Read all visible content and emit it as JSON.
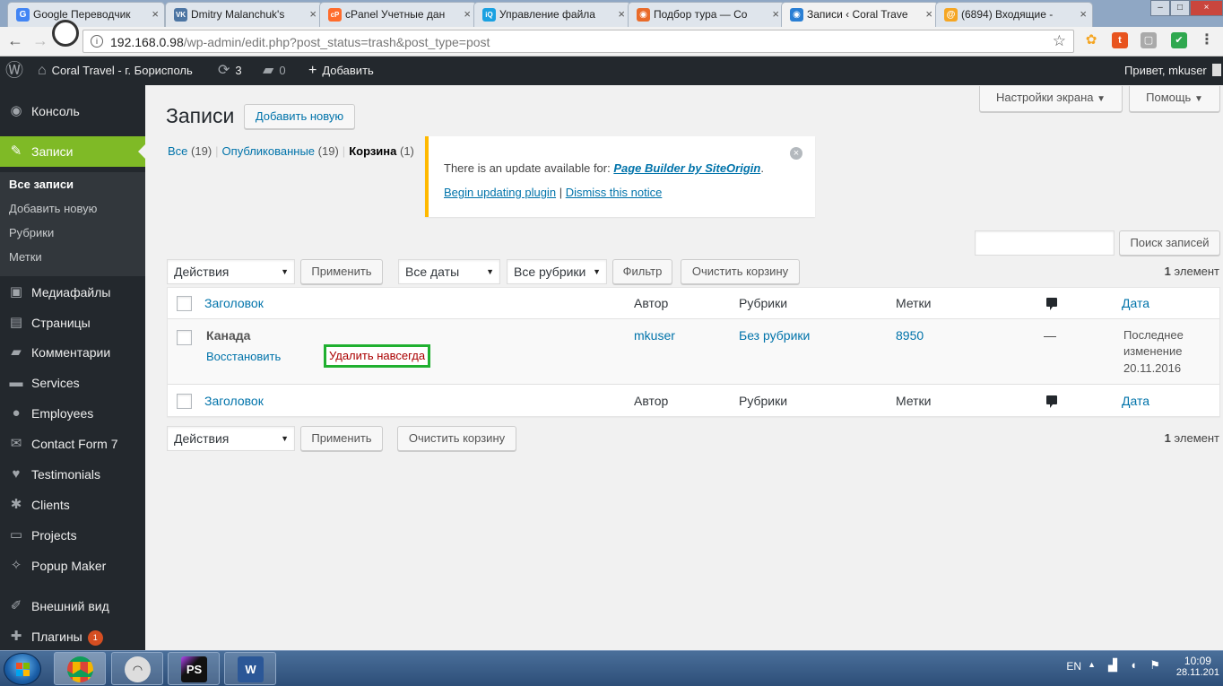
{
  "browser": {
    "tabs": [
      {
        "title": "Google Переводчик",
        "favicon": "G",
        "color": "#4285f4",
        "active": false
      },
      {
        "title": "Dmitry Malanchuk's",
        "favicon": "VK",
        "color": "#4c75a3",
        "active": false
      },
      {
        "title": "cPanel Учетные дан",
        "favicon": "cP",
        "color": "#ff6c2c",
        "active": false
      },
      {
        "title": "Управление файла",
        "favicon": "iQ",
        "color": "#1aa1e1",
        "active": false
      },
      {
        "title": "Подбор тура — Co",
        "favicon": "◉",
        "color": "#e96b2a",
        "active": false
      },
      {
        "title": "Записи ‹ Coral Trave",
        "favicon": "◉",
        "color": "#2a7fd4",
        "active": true
      },
      {
        "title": "(6894) Входящие - ",
        "favicon": "@",
        "color": "#f5a623",
        "active": false
      }
    ],
    "url_host": "192.168.0.98",
    "url_path": "/wp-admin/edit.php?post_status=trash&post_type=post"
  },
  "adminbar": {
    "site_name": "Coral Travel - г. Борисполь",
    "updates_count": "3",
    "comments_count": "0",
    "new_label": "Добавить",
    "greeting": "Привет, mkuser"
  },
  "sidebar": {
    "items": [
      {
        "label": "Консоль",
        "icon": "dashboard-icon",
        "glyph": "◉"
      },
      {
        "label": "Записи",
        "icon": "pin-icon",
        "glyph": "✎"
      },
      {
        "label": "Медиафайлы",
        "icon": "media-icon",
        "glyph": "▣"
      },
      {
        "label": "Страницы",
        "icon": "pages-icon",
        "glyph": "▤"
      },
      {
        "label": "Комментарии",
        "icon": "comments-icon",
        "glyph": "▰"
      },
      {
        "label": "Services",
        "icon": "folder-icon",
        "glyph": "▬"
      },
      {
        "label": "Employees",
        "icon": "person-icon",
        "glyph": "●"
      },
      {
        "label": "Contact Form 7",
        "icon": "mail-icon",
        "glyph": "✉"
      },
      {
        "label": "Testimonials",
        "icon": "heart-icon",
        "glyph": "♥"
      },
      {
        "label": "Clients",
        "icon": "group-icon",
        "glyph": "✱"
      },
      {
        "label": "Projects",
        "icon": "monitor-icon",
        "glyph": "▭"
      },
      {
        "label": "Popup Maker",
        "icon": "popup-icon",
        "glyph": "✧"
      },
      {
        "label": "Внешний вид",
        "icon": "brush-icon",
        "glyph": "✐"
      },
      {
        "label": "Плагины",
        "icon": "plugin-icon",
        "glyph": "✚",
        "badge": "1"
      }
    ],
    "submenu": [
      "Все записи",
      "Добавить новую",
      "Рубрики",
      "Метки"
    ]
  },
  "header": {
    "title": "Записи",
    "add_new": "Добавить новую",
    "screen_options": "Настройки экрана",
    "help": "Помощь"
  },
  "views": {
    "all_label": "Все",
    "all_count": "(19)",
    "published_label": "Опубликованные",
    "published_count": "(19)",
    "trash_label": "Корзина",
    "trash_count": "(1)"
  },
  "notice": {
    "text": "There is an update available for: ",
    "plugin": "Page Builder by SiteOrigin",
    "period": ".",
    "update_link": "Begin updating plugin",
    "separator": "|",
    "dismiss_link": "Dismiss this notice"
  },
  "search": {
    "button": "Поиск записей",
    "value": ""
  },
  "tablenav": {
    "bulk_action": "Действия",
    "apply": "Применить",
    "dates": "Все даты",
    "categories": "Все рубрики",
    "filter": "Фильтр",
    "empty_trash": "Очистить корзину",
    "count": "1",
    "count_label": "элемент"
  },
  "table": {
    "columns": {
      "title": "Заголовок",
      "author": "Автор",
      "categories": "Рубрики",
      "tags": "Метки",
      "date": "Дата"
    },
    "rows": [
      {
        "title": "Канада",
        "restore": "Восстановить",
        "delete": "Удалить навсегда",
        "author": "mkuser",
        "categories": "Без рубрики",
        "tags": "8950",
        "comments": "—",
        "date_status": "Последнее",
        "date_status2": "изменение",
        "date": "20.11.2016"
      }
    ]
  },
  "taskbar": {
    "lang": "EN",
    "time": "10:09",
    "date": "28.11.201"
  }
}
